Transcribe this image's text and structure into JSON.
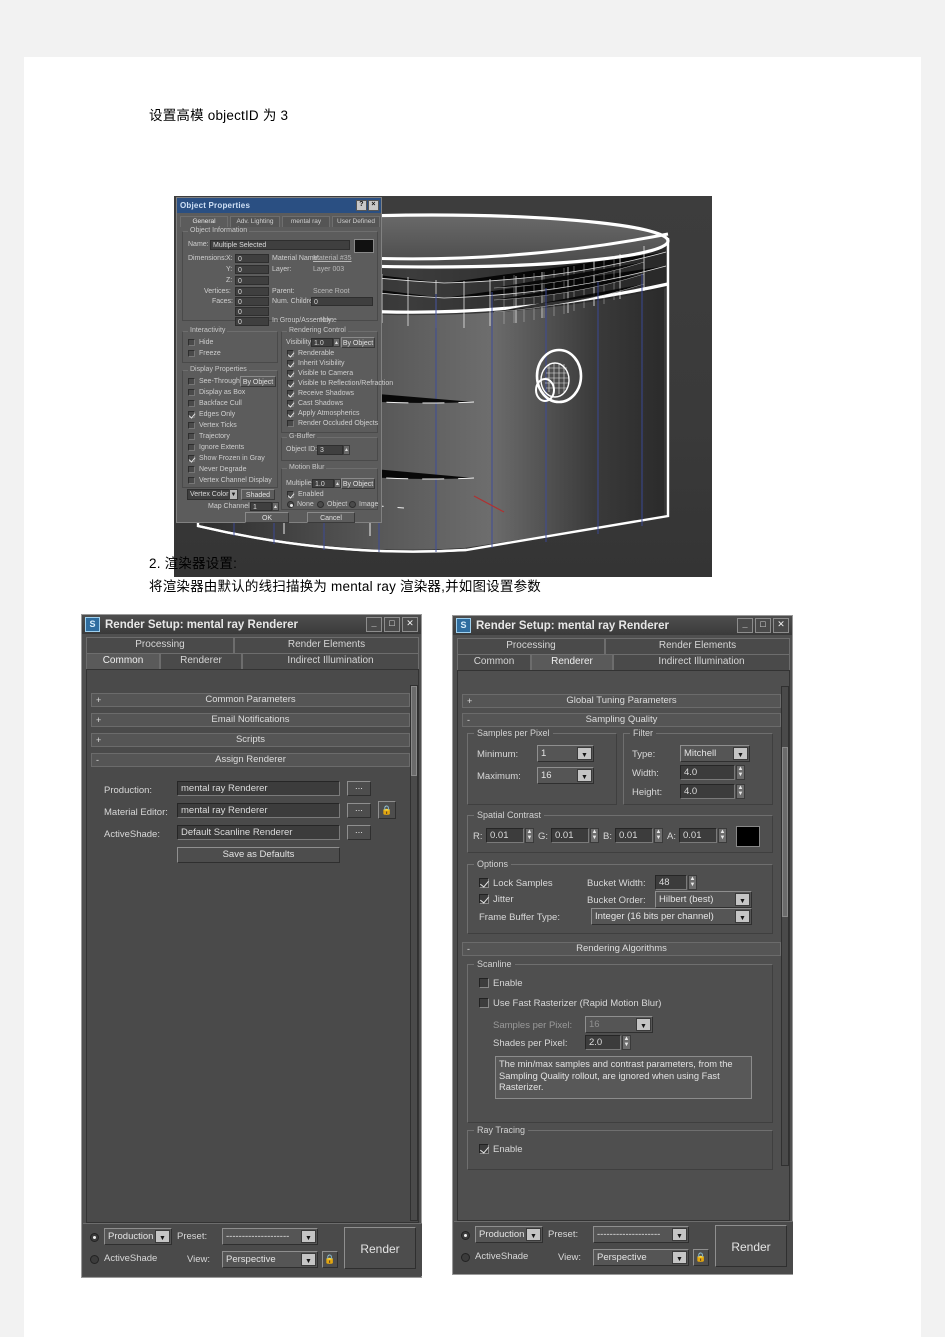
{
  "document": {
    "heading1": "设置高模 objectID 为 3",
    "step2_title": "2.   渲染器设置:",
    "step2_body": "将渲染器由默认的线扫描换为 mental ray 渲染器,并如图设置参数"
  },
  "object_properties": {
    "title": "Object Properties",
    "help_btn": "?",
    "close_btn": "×",
    "tabs": [
      "General",
      "Adv. Lighting",
      "mental ray",
      "User Defined"
    ],
    "selected_tab": "General",
    "object_information": {
      "group": "Object Information",
      "name_label": "Name:",
      "name_value": "Multiple Selected",
      "dimensions_label": "Dimensions:",
      "x_label": "X:",
      "x_value": "0",
      "y_label": "Y:",
      "y_value": "0",
      "z_label": "Z:",
      "z_value": "0",
      "vertices_label": "Vertices:",
      "vertices_value": "0",
      "faces_label": "Faces:",
      "faces_value": "0",
      "extra1": "0",
      "extra2": "0",
      "material_name_label": "Material Name:",
      "material_name_value": "Material #35",
      "layer_label": "Layer:",
      "layer_value": "Layer 003",
      "parent_label": "Parent:",
      "parent_value": "Scene Root",
      "num_children_label": "Num. Children:",
      "num_children_value": "0",
      "in_group_label": "In Group/Assembly:",
      "in_group_value": "None"
    },
    "interactivity": {
      "group": "Interactivity",
      "items": [
        {
          "label": "Hide",
          "checked": false
        },
        {
          "label": "Freeze",
          "checked": false
        }
      ]
    },
    "display_properties": {
      "group": "Display Properties",
      "by_object_btn": "By Object",
      "items": [
        {
          "label": "See-Through",
          "checked": false
        },
        {
          "label": "Display as Box",
          "checked": false
        },
        {
          "label": "Backface Cull",
          "checked": false
        },
        {
          "label": "Edges Only",
          "checked": true
        },
        {
          "label": "Vertex Ticks",
          "checked": false
        },
        {
          "label": "Trajectory",
          "checked": false
        },
        {
          "label": "Ignore Extents",
          "checked": false
        },
        {
          "label": "Show Frozen in Gray",
          "checked": true
        },
        {
          "label": "Never Degrade",
          "checked": false
        },
        {
          "label": "Vertex Channel Display",
          "checked": false
        }
      ],
      "vertex_color_dropdown": "Vertex Color",
      "shaded_btn": "Shaded",
      "map_channel_label": "Map Channel:",
      "map_channel_value": "1"
    },
    "rendering_control": {
      "group": "Rendering Control",
      "visibility_label": "Visibility:",
      "visibility_value": "1.0",
      "by_object_btn": "By Object",
      "items": [
        {
          "label": "Renderable",
          "checked": true
        },
        {
          "label": "Inherit Visibility",
          "checked": true
        },
        {
          "label": "Visible to Camera",
          "checked": true
        },
        {
          "label": "Visible to Reflection/Refraction",
          "checked": true
        },
        {
          "label": "Receive Shadows",
          "checked": true
        },
        {
          "label": "Cast Shadows",
          "checked": true
        },
        {
          "label": "Apply Atmospherics",
          "checked": true
        },
        {
          "label": "Render Occluded Objects",
          "checked": false
        }
      ]
    },
    "g_buffer": {
      "group": "G-Buffer",
      "object_id_label": "Object ID:",
      "object_id_value": "3"
    },
    "motion_blur": {
      "group": "Motion Blur",
      "multiplier_label": "Multiplier:",
      "multiplier_value": "1.0",
      "by_object_btn": "By Object",
      "enabled_label": "Enabled",
      "enabled_checked": true,
      "options": [
        "None",
        "Object",
        "Image"
      ],
      "selected_option": "None"
    },
    "ok_btn": "OK",
    "cancel_btn": "Cancel"
  },
  "render_setup_left": {
    "title": "Render Setup: mental ray Renderer",
    "logo": "S",
    "min_btn": "_",
    "max_btn": "□",
    "close_btn": "✕",
    "tabs_row1": [
      "Processing",
      "Render Elements"
    ],
    "tabs_row2": [
      "Common",
      "Renderer",
      "Indirect Illumination"
    ],
    "selected_tab": "Common",
    "rollouts": [
      {
        "sign": "+",
        "label": "Common Parameters"
      },
      {
        "sign": "+",
        "label": "Email Notifications"
      },
      {
        "sign": "+",
        "label": "Scripts"
      },
      {
        "sign": "-",
        "label": "Assign Renderer"
      }
    ],
    "assign_renderer": {
      "production_label": "Production:",
      "production_value": "mental ray Renderer",
      "material_editor_label": "Material Editor:",
      "material_editor_value": "mental ray Renderer",
      "activeshade_label": "ActiveShade:",
      "activeshade_value": "Default Scanline Renderer",
      "browse_btn": "...",
      "lock_icon": "lock",
      "save_defaults_btn": "Save as Defaults"
    },
    "footer": {
      "production_radio": "Production",
      "activeshade_radio": "ActiveShade",
      "selected_radio": "Production",
      "preset_label": "Preset:",
      "preset_value": "--------------------",
      "view_label": "View:",
      "view_value": "Perspective",
      "lock_icon": "lock",
      "render_btn": "Render"
    }
  },
  "render_setup_right": {
    "title": "Render Setup: mental ray Renderer",
    "logo": "S",
    "min_btn": "_",
    "max_btn": "□",
    "close_btn": "✕",
    "tabs_row1": [
      "Processing",
      "Render Elements"
    ],
    "tabs_row2": [
      "Common",
      "Renderer",
      "Indirect Illumination"
    ],
    "selected_tab": "Renderer",
    "rollouts": [
      {
        "sign": "+",
        "label": "Global Tuning Parameters"
      },
      {
        "sign": "-",
        "label": "Sampling Quality"
      },
      {
        "sign": "-",
        "label": "Rendering Algorithms"
      }
    ],
    "samples_per_pixel": {
      "group": "Samples per Pixel",
      "minimum_label": "Minimum:",
      "minimum_value": "1",
      "maximum_label": "Maximum:",
      "maximum_value": "16"
    },
    "filter": {
      "group": "Filter",
      "type_label": "Type:",
      "type_value": "Mitchell",
      "width_label": "Width:",
      "width_value": "4.0",
      "height_label": "Height:",
      "height_value": "4.0"
    },
    "spatial_contrast": {
      "group": "Spatial Contrast",
      "r_label": "R:",
      "r_value": "0.01",
      "g_label": "G:",
      "g_value": "0.01",
      "b_label": "B:",
      "b_value": "0.01",
      "a_label": "A:",
      "a_value": "0.01",
      "swatch_color": "#000000"
    },
    "options": {
      "group": "Options",
      "lock_samples_label": "Lock Samples",
      "lock_samples_checked": true,
      "jitter_label": "Jitter",
      "jitter_checked": true,
      "bucket_width_label": "Bucket Width:",
      "bucket_width_value": "48",
      "bucket_order_label": "Bucket Order:",
      "bucket_order_value": "Hilbert (best)",
      "frame_buffer_label": "Frame Buffer Type:",
      "frame_buffer_value": "Integer (16 bits per channel)"
    },
    "scanline": {
      "group": "Scanline",
      "enable_label": "Enable",
      "enable_checked": false,
      "fast_rasterizer_label": "Use Fast Rasterizer (Rapid Motion Blur)",
      "fast_rasterizer_checked": false,
      "samples_per_pixel_label": "Samples per Pixel:",
      "samples_per_pixel_value": "16",
      "shades_per_pixel_label": "Shades per Pixel:",
      "shades_per_pixel_value": "2.0",
      "info_text": "The min/max samples and contrast parameters, from the Sampling Quality rollout, are ignored when using Fast Rasterizer."
    },
    "ray_tracing": {
      "group": "Ray Tracing",
      "enable_label": "Enable",
      "enable_checked": true
    },
    "footer": {
      "production_radio": "Production",
      "activeshade_radio": "ActiveShade",
      "selected_radio": "Production",
      "preset_label": "Preset:",
      "preset_value": "--------------------",
      "view_label": "View:",
      "view_value": "Perspective",
      "lock_icon": "lock",
      "render_btn": "Render"
    }
  },
  "colors": {
    "page_bg": "#ffffff",
    "outer_bg": "#f2f2f2",
    "dialog_bg": "#5c5c5c",
    "titlebar_blue": "#2a4f82",
    "viewport_bg": "#3b3b3b"
  }
}
